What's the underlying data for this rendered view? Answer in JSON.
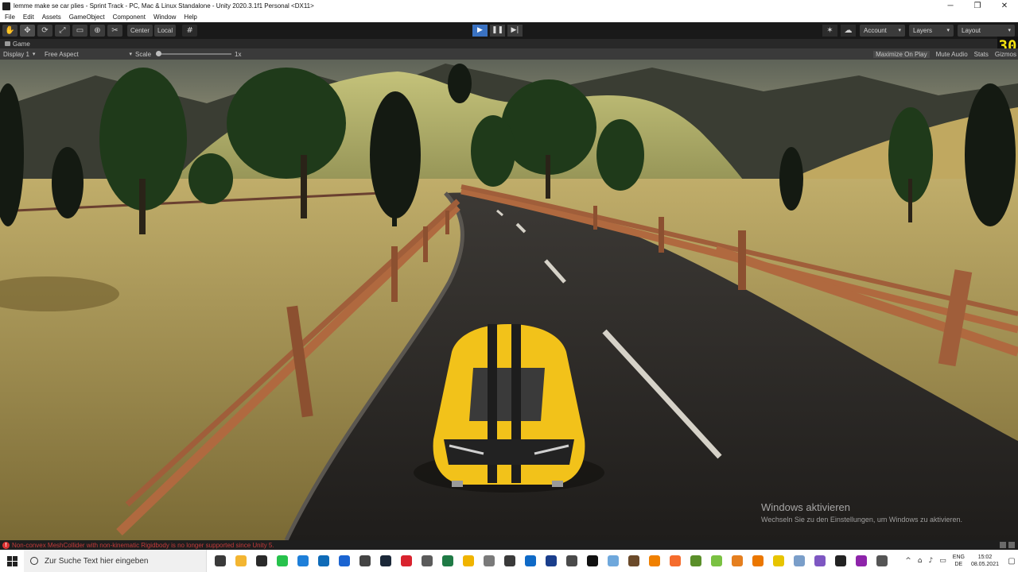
{
  "window": {
    "title": "lemme make se car plies - Sprint Track - PC, Mac & Linux Standalone - Unity 2020.3.1f1 Personal <DX11>",
    "controls": [
      "─",
      "❐",
      "✕"
    ]
  },
  "menu": [
    "File",
    "Edit",
    "Assets",
    "GameObject",
    "Component",
    "Window",
    "Help"
  ],
  "toolbar": {
    "tools": [
      "✋",
      "✥",
      "⟳",
      "⤢",
      "▭",
      "⊕",
      "✂"
    ],
    "pivot_center": "Center",
    "pivot_local": "Local",
    "grid_icon": "#",
    "play_icon": "▶",
    "pause_icon": "❚❚",
    "step_icon": "▶|",
    "collab_icon": "✶",
    "cloud_icon": "☁",
    "account_label": "Account",
    "layers_label": "Layers",
    "layout_label": "Layout",
    "caret": "▾"
  },
  "game_tab": {
    "label": "Game",
    "fps_counter": "30"
  },
  "game_bar": {
    "display": "Display 1",
    "aspect": "Free Aspect",
    "scale_label": "Scale",
    "scale_value": "1x",
    "scale_level": 0,
    "maximize_on_play": "Maximize On Play",
    "mute_audio": "Mute Audio",
    "stats": "Stats",
    "gizmos": "Gizmos"
  },
  "scene": {
    "sky_color": "#8a8a78",
    "grass_color": "#a8924e",
    "road_color": "#2e2b27",
    "fence_color": "#a05e3a",
    "car_color": "#f2c21a",
    "tree_color": "#1e3a1a"
  },
  "watermark": {
    "title": "Windows aktivieren",
    "subtitle": "Wechseln Sie zu den Einstellungen, um Windows zu aktivieren."
  },
  "console": {
    "error_icon": "!",
    "message": "Non-convex MeshCollider with non-kinematic Rigidbody is no longer supported since Unity 5."
  },
  "taskbar": {
    "search_placeholder": "Zur Suche Text hier eingeben",
    "apps": [
      {
        "name": "task-view-icon",
        "color": "#3a3a3a"
      },
      {
        "name": "file-explorer-icon",
        "color": "#f3b531"
      },
      {
        "name": "obs-icon",
        "color": "#2a2a2a"
      },
      {
        "name": "whatsapp-icon",
        "color": "#27c24c"
      },
      {
        "name": "store-icon",
        "color": "#1e7fd9"
      },
      {
        "name": "edge-icon",
        "color": "#0f6bb8"
      },
      {
        "name": "malwarebytes-icon",
        "color": "#1b64d1"
      },
      {
        "name": "briefcase-icon",
        "color": "#444444"
      },
      {
        "name": "steam-icon",
        "color": "#1b2838"
      },
      {
        "name": "opera-icon",
        "color": "#d9232e"
      },
      {
        "name": "mail-icon",
        "color": "#5b5b5b"
      },
      {
        "name": "excel-icon",
        "color": "#1f7a45"
      },
      {
        "name": "app-yellow-icon",
        "color": "#f0b400"
      },
      {
        "name": "photos-icon",
        "color": "#7a7a7a"
      },
      {
        "name": "shield-icon",
        "color": "#3a3a3a"
      },
      {
        "name": "outlook-icon",
        "color": "#0f6ac7"
      },
      {
        "name": "headphones-icon",
        "color": "#1a3e8c"
      },
      {
        "name": "chat-icon",
        "color": "#4a4a4a"
      },
      {
        "name": "unity-icon",
        "color": "#111111"
      },
      {
        "name": "arrow-icon",
        "color": "#6fa8dc"
      },
      {
        "name": "winrar-icon",
        "color": "#6b4a2a"
      },
      {
        "name": "vlc-icon",
        "color": "#f08000"
      },
      {
        "name": "origin-icon",
        "color": "#f56c2d"
      },
      {
        "name": "minecraft-icon",
        "color": "#5a8f2a"
      },
      {
        "name": "bluestacks-icon",
        "color": "#7ac142"
      },
      {
        "name": "autodesk-icon",
        "color": "#e57f1f"
      },
      {
        "name": "blender-icon",
        "color": "#eb7700"
      },
      {
        "name": "pen-icon",
        "color": "#e7c400"
      },
      {
        "name": "notepad-icon",
        "color": "#7a9ec9"
      },
      {
        "name": "visual-studio-icon",
        "color": "#7e57c2"
      },
      {
        "name": "unity-hub-icon",
        "color": "#222222"
      },
      {
        "name": "tor-icon",
        "color": "#8e24aa"
      },
      {
        "name": "calculator-icon",
        "color": "#555555"
      }
    ],
    "tray_chevron": "^",
    "tray_icons": [
      "⌂",
      "♪",
      "▭"
    ],
    "language_top": "ENG",
    "language_bottom": "DE",
    "time": "15:02",
    "date": "08.05.2021",
    "notification_icon": "▢"
  }
}
